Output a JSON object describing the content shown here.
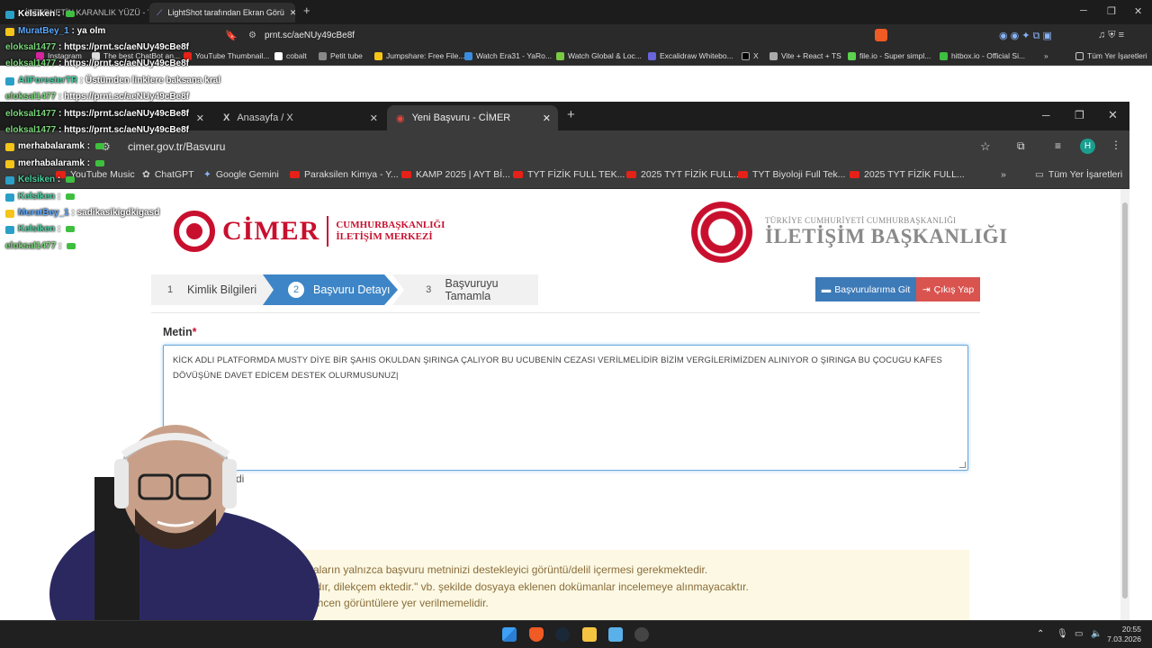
{
  "outer_browser": {
    "tabs": [
      {
        "label": "İNTERNETİN KARANLIK YÜZÜ - You"
      },
      {
        "label": "LightShot tarafından Ekran Görü"
      }
    ],
    "url": "prnt.sc/aeNUy49cBe8f",
    "bookmarks": [
      "Instagram",
      "The best ChatBot an...",
      "YouTube Thumbnail...",
      "cobalt",
      "Petit tube",
      "Jumpshare: Free File...",
      "Watch Era31 - YaRo...",
      "Watch Global & Loc...",
      "Excalidraw Whitebo...",
      "X",
      "Vite + React + TS",
      "file.io - Super simpl...",
      "hitbox.io - Official Si...",
      "Tüm Yer İşaretleri"
    ]
  },
  "chat": [
    {
      "user": "Kelsiken",
      "msg": ""
    },
    {
      "user": "MuratBey_1",
      "msg": "ya olm"
    },
    {
      "user": "eloksal1477",
      "msg": "https://prnt.sc/aeNUy49cBe8f"
    },
    {
      "user": "eloksal1477",
      "msg": "https://prnt.sc/aeNUy49cBe8f"
    },
    {
      "user": "AliForesterTR",
      "msg": "Üstümden linklere baksana kral"
    },
    {
      "user": "eloksal1477",
      "msg": "https://prnt.sc/aeNUy49cBe8f"
    },
    {
      "user": "eloksal1477",
      "msg": "https://prnt.sc/aeNUy49cBe8f"
    },
    {
      "user": "eloksal1477",
      "msg": "https://prnt.sc/aeNUy49cBe8f"
    },
    {
      "user": "merhabalaramk",
      "msg": ""
    },
    {
      "user": "merhabalaramk",
      "msg": ""
    },
    {
      "user": "Kelsiken",
      "msg": ""
    },
    {
      "user": "Kelsiken",
      "msg": ""
    },
    {
      "user": "MuratBey_1",
      "msg": "sadikasikigdkigasd"
    },
    {
      "user": "Kelsiken",
      "msg": ""
    },
    {
      "user": "eloksal1477",
      "msg": ""
    }
  ],
  "inner_browser": {
    "tabs": [
      {
        "label": ""
      },
      {
        "label": "Anasayfa / X"
      },
      {
        "label": "Yeni Başvuru - CİMER"
      }
    ],
    "url": "cimer.gov.tr/Basvuru",
    "profile_initial": "H",
    "bookmarks": [
      "YouTube Music",
      "ChatGPT",
      "Google Gemini",
      "Paraksilen Kimya - Y...",
      "KAMP 2025 | AYT Bİ...",
      "TYT FİZİK FULL TEK...",
      "2025 TYT FİZİK FULL...",
      "TYT Biyoloji Full Tek...",
      "2025 TYT FİZİK FULL...",
      "Tüm Yer İşaretleri"
    ]
  },
  "page": {
    "cimer_logo": {
      "name": "CİMER",
      "sub1": "CUMHURBAŞKANLIĞI",
      "sub2": "İLETİŞİM MERKEZİ"
    },
    "ib_logo": {
      "small": "TÜRKİYE CUMHURİYETİ CUMHURBAŞKANLIĞI",
      "big": "İLETİŞİM BAŞKANLIĞI"
    },
    "steps": [
      {
        "num": "1",
        "label": "Kimlik Bilgileri"
      },
      {
        "num": "2",
        "label": "Başvuru Detayı"
      },
      {
        "num": "3",
        "label": "Başvuruyu Tamamla"
      }
    ],
    "btn_basvurular": "Başvurularıma Git",
    "btn_cikis": "Çıkış Yap",
    "metin_label": "Metin",
    "metin_required": "*",
    "metin_value": "KİCK ADLI PLATFORMDA MUSTY DİYE BİR ŞAHIS OKULDAN ŞIRINGA ÇALIYOR BU UCUBENİN CEZASI VERİLMELİDİR BİZİM VERGİLERİMİZDEN ALINIYOR O ŞIRINGA BU ÇOCUGU KAFES DÖVÜŞÜNE DAVET EDİCEM DESTEK OLURMUSUNUZ",
    "partial_label": "di",
    "notice_lines": [
      "syaların yalnızca başvuru metninizi destekleyici görüntü/delil içermesi gerekmektedir.",
      "aktadır, dilekçem ektedir.\" vb. şekilde dosyaya eklenen dokümanlar incelemeye alınmayacaktır.",
      "üstehcen görüntülere yer verilmemelidir."
    ]
  },
  "taskbar": {
    "time": "20:55",
    "date": "7.03.2026"
  }
}
